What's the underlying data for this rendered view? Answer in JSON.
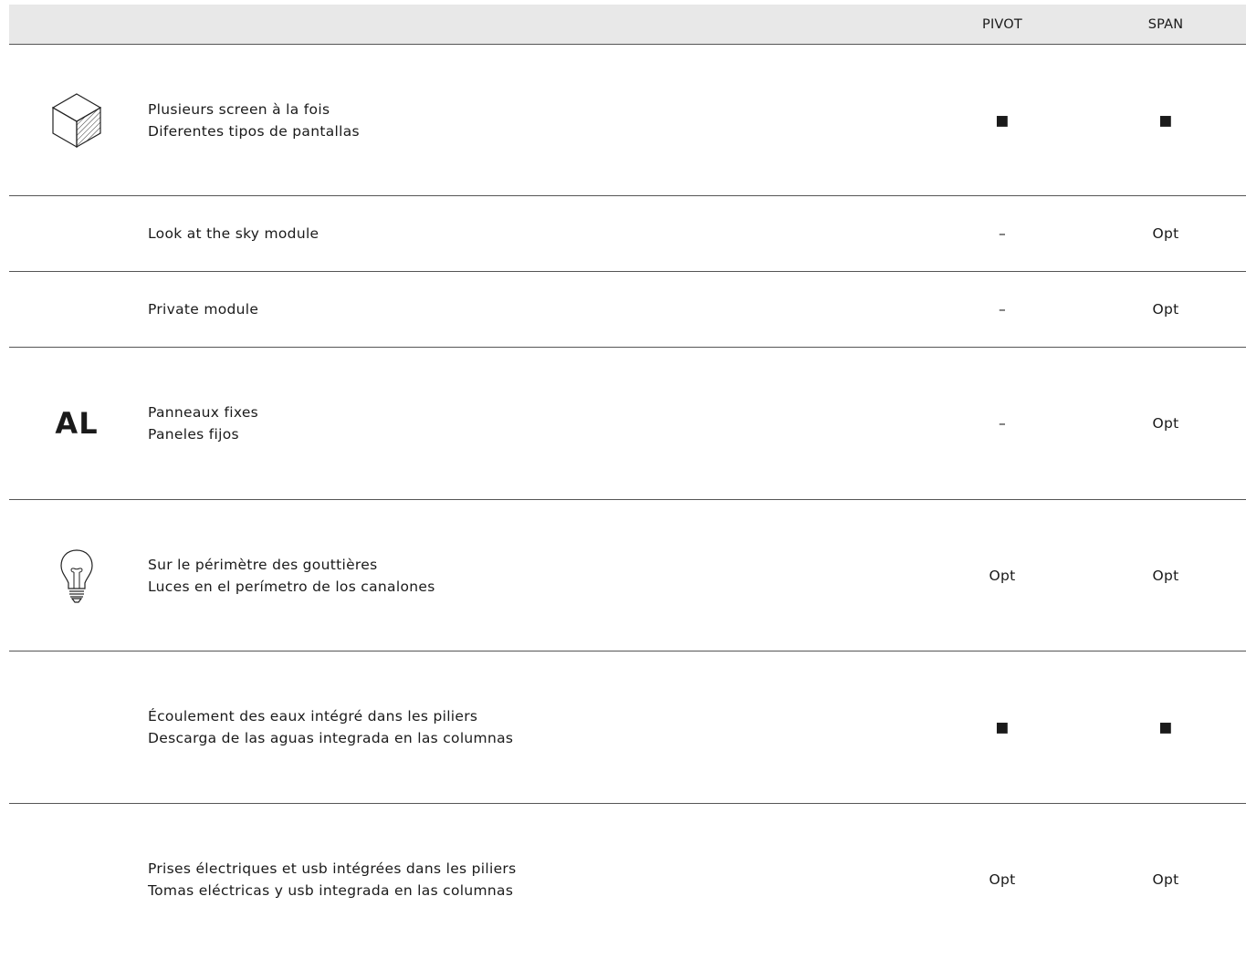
{
  "header": {
    "col_pivot": "PIVOT",
    "col_span": "SPAN"
  },
  "rows": [
    {
      "icon": "cube-icon",
      "lines": [
        "Plusieurs screen à la fois",
        "Diferentes tipos de pantallas"
      ],
      "pivot": "■",
      "span": "■"
    },
    {
      "icon": "",
      "lines": [
        "Look at the sky module"
      ],
      "pivot": "–",
      "span": "Opt"
    },
    {
      "icon": "",
      "lines": [
        "Private module"
      ],
      "pivot": "–",
      "span": "Opt"
    },
    {
      "icon": "al-logo",
      "icon_text": "AL",
      "lines": [
        "Panneaux fixes",
        "Paneles fijos"
      ],
      "pivot": "–",
      "span": "Opt"
    },
    {
      "icon": "lightbulb-icon",
      "lines": [
        "Sur le périmètre des gouttières",
        "Luces en el perímetro de los canalones"
      ],
      "pivot": "Opt",
      "span": "Opt"
    },
    {
      "icon": "",
      "lines": [
        "Écoulement des eaux intégré dans les piliers",
        "Descarga de las aguas integrada en las columnas"
      ],
      "pivot": "■",
      "span": "■"
    },
    {
      "icon": "",
      "lines": [
        "Prises électriques et usb intégrées dans les piliers",
        "Tomas eléctricas y usb integrada en las columnas"
      ],
      "pivot": "Opt",
      "span": "Opt"
    }
  ]
}
